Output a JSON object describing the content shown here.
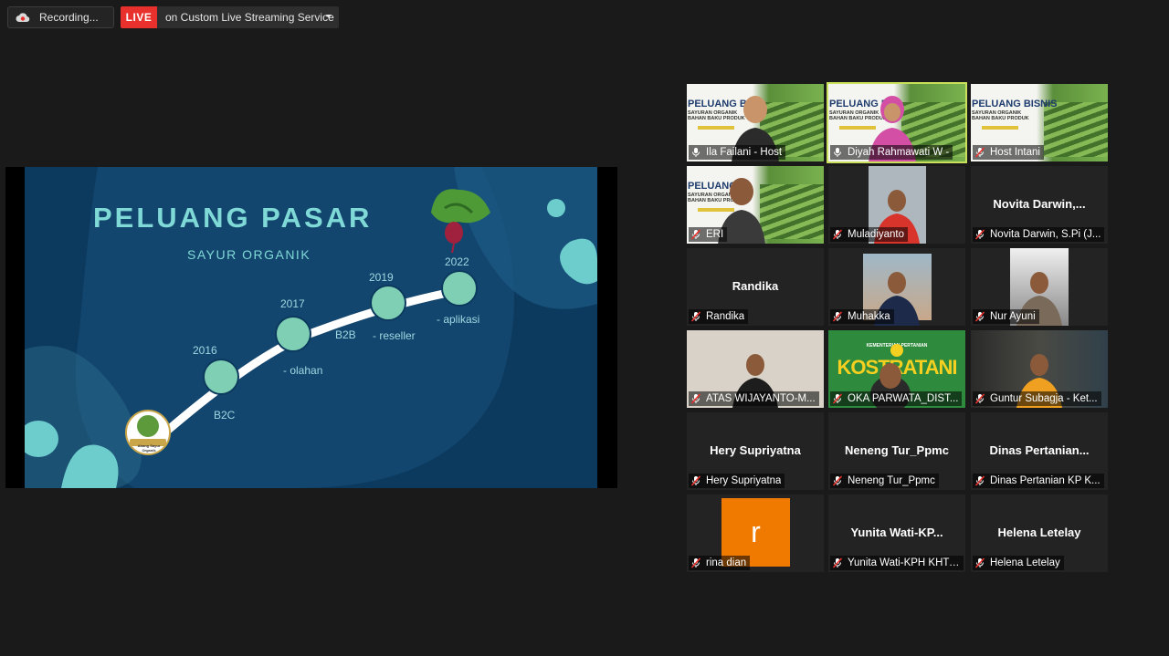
{
  "topbar": {
    "recording_label": "Recording...",
    "live_badge": "LIVE",
    "stream_label": "on Custom Live Streaming Service"
  },
  "slide": {
    "title": "PELUANG PASAR",
    "subtitle": "SAYUR ORGANIK",
    "timeline": [
      {
        "year": "2016",
        "caption": "B2C"
      },
      {
        "year": "2017",
        "caption": "- olahan"
      },
      {
        "year": "",
        "caption": "B2B"
      },
      {
        "year": "2019",
        "caption": "- reseller"
      },
      {
        "year": "2022",
        "caption": "- aplikasi"
      }
    ],
    "logo_text": "Abang Sayur Organik"
  },
  "banner": {
    "title_ila": "PELUANG B",
    "title_diyah": "PELUANG B",
    "title_host": "PELUANG BISNIS",
    "sub_1": "SAYURAN ORGANIK",
    "sub_2": "BAHAN BAKU PRODUK"
  },
  "participants": [
    {
      "label": "Ila Failani - Host",
      "muted": false
    },
    {
      "label": "Diyah Rahmawati W -",
      "muted": false,
      "active": true
    },
    {
      "label": "Host Intani",
      "muted": true
    },
    {
      "label": "ERI",
      "muted": true
    },
    {
      "label": "Muladiyanto",
      "muted": true
    },
    {
      "big": "Novita  Darwin,...",
      "label": "Novita Darwin, S.Pi (J...",
      "muted": true
    },
    {
      "big": "Randika",
      "label": "Randika",
      "muted": true
    },
    {
      "label": "Muhakka",
      "muted": true
    },
    {
      "label": "Nur Ayuni",
      "muted": true
    },
    {
      "label": "ATAS WIJAYANTO-M...",
      "muted": true
    },
    {
      "label": "OKA PARWATA_DIST...",
      "muted": true,
      "overlay": "KOSTRATANI",
      "overlay_small": "KEMENTERIAN PERTANIAN"
    },
    {
      "label": "Guntur Subagja - Ket...",
      "muted": true
    },
    {
      "big": "Hery Supriyatna",
      "label": "Hery Supriyatna",
      "muted": true
    },
    {
      "big": "Neneng Tur_Ppmc",
      "label": "Neneng Tur_Ppmc",
      "muted": true
    },
    {
      "big": "Dinas  Pertanian...",
      "label": "Dinas Pertanian KP K...",
      "muted": true
    },
    {
      "avatar_letter": "r",
      "label": "rina dian",
      "muted": true
    },
    {
      "big": "Yunita  Wati-KP...",
      "label": "Yunita Wati-KPH KHTi...",
      "muted": true
    },
    {
      "big": "Helena Letelay",
      "label": "Helena Letelay",
      "muted": true
    }
  ],
  "colors": {
    "live": "#e8312c",
    "active_border": "#c8e05a",
    "slide_bg": "#0c3a5e",
    "accent": "#7fd9d6",
    "avatar": "#f07a00"
  }
}
